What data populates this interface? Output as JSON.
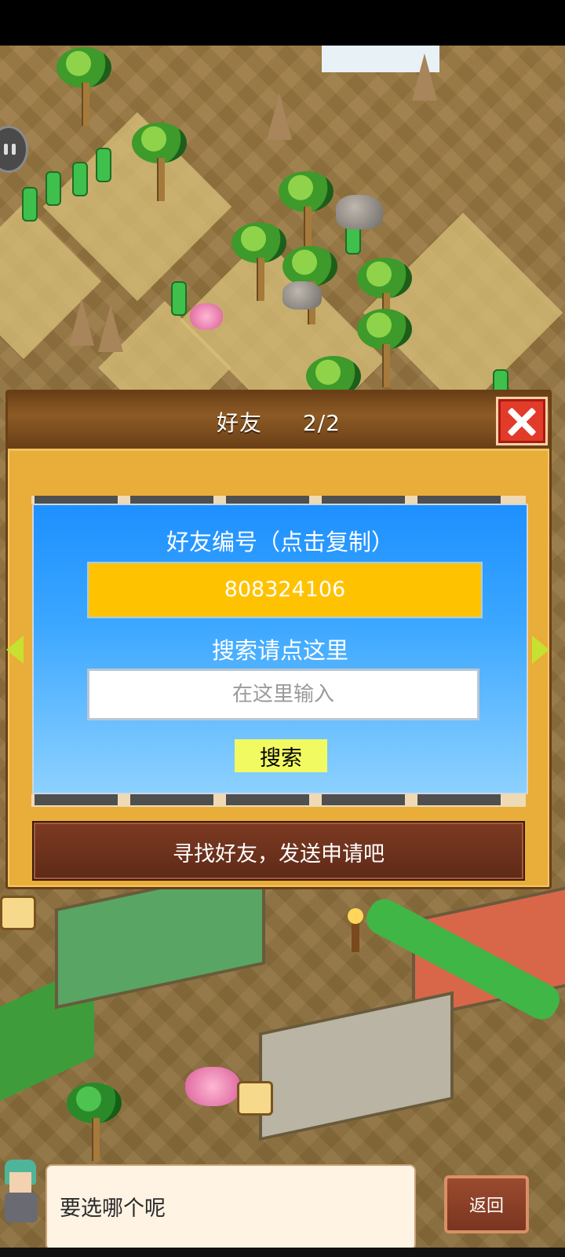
{
  "dialog": {
    "title": "好友",
    "page_indicator": "2/2"
  },
  "panel": {
    "friend_id_label": "好友编号（点击复制）",
    "friend_id_value": "808324106",
    "search_hint": "搜索请点这里",
    "search_placeholder": "在这里输入",
    "search_button": "搜索"
  },
  "footer": {
    "message": "寻找好友，发送申请吧"
  },
  "bottom": {
    "speech_text": "要选哪个呢",
    "back_button": "返回"
  },
  "icons": [
    "close-icon",
    "arrow-left-icon",
    "arrow-right-icon",
    "pause-icon",
    "visitor-marker-icon"
  ],
  "colors": {
    "dialog_bg": "#e9ad3a",
    "panel_blue": "#1e90ff",
    "id_box": "#ffc200",
    "search_button": "#f2fa62",
    "close_red": "#e23b2a",
    "footer_brown": "#6e3220"
  }
}
